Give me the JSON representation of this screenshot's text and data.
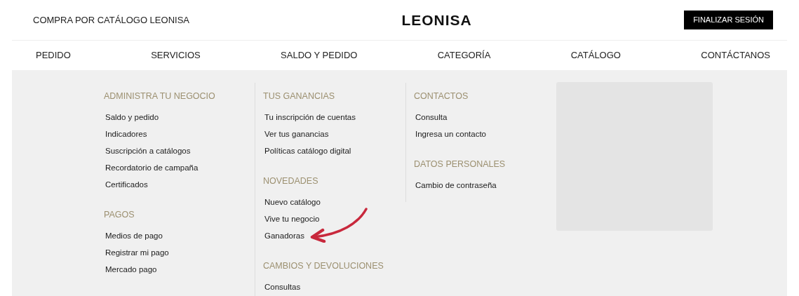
{
  "header": {
    "tagline": "COMPRA POR CATÁLOGO LEONISA",
    "logo": "LEONISA",
    "logout_button": "FINALIZAR SESIÓN"
  },
  "nav": [
    "PEDIDO",
    "SERVICIOS",
    "SALDO Y PEDIDO",
    "CATEGORÍA",
    "CATÁLOGO",
    "CONTÁCTANOS"
  ],
  "menu_columns": [
    {
      "sections": [
        {
          "heading": "ADMINISTRA TU NEGOCIO",
          "items": [
            "Saldo y pedido",
            "Indicadores",
            "Suscripción a catálogos",
            "Recordatorio de campaña",
            "Certificados"
          ]
        },
        {
          "heading": "PAGOS",
          "items": [
            "Medios de pago",
            "Registrar mi pago",
            "Mercado pago"
          ]
        }
      ]
    },
    {
      "sections": [
        {
          "heading": "TUS GANANCIAS",
          "items": [
            "Tu inscripción de cuentas",
            "Ver tus ganancias",
            "Políticas catálogo digital"
          ]
        },
        {
          "heading": "NOVEDADES",
          "items": [
            "Nuevo catálogo",
            "Vive tu negocio",
            "Ganadoras"
          ]
        },
        {
          "heading": "CAMBIOS Y DEVOLUCIONES",
          "items": [
            "Consultas"
          ]
        }
      ]
    },
    {
      "sections": [
        {
          "heading": "CONTACTOS",
          "items": [
            "Consulta",
            "Ingresa un contacto"
          ]
        },
        {
          "heading": "DATOS PERSONALES",
          "items": [
            "Cambio de contraseña"
          ]
        }
      ]
    }
  ]
}
